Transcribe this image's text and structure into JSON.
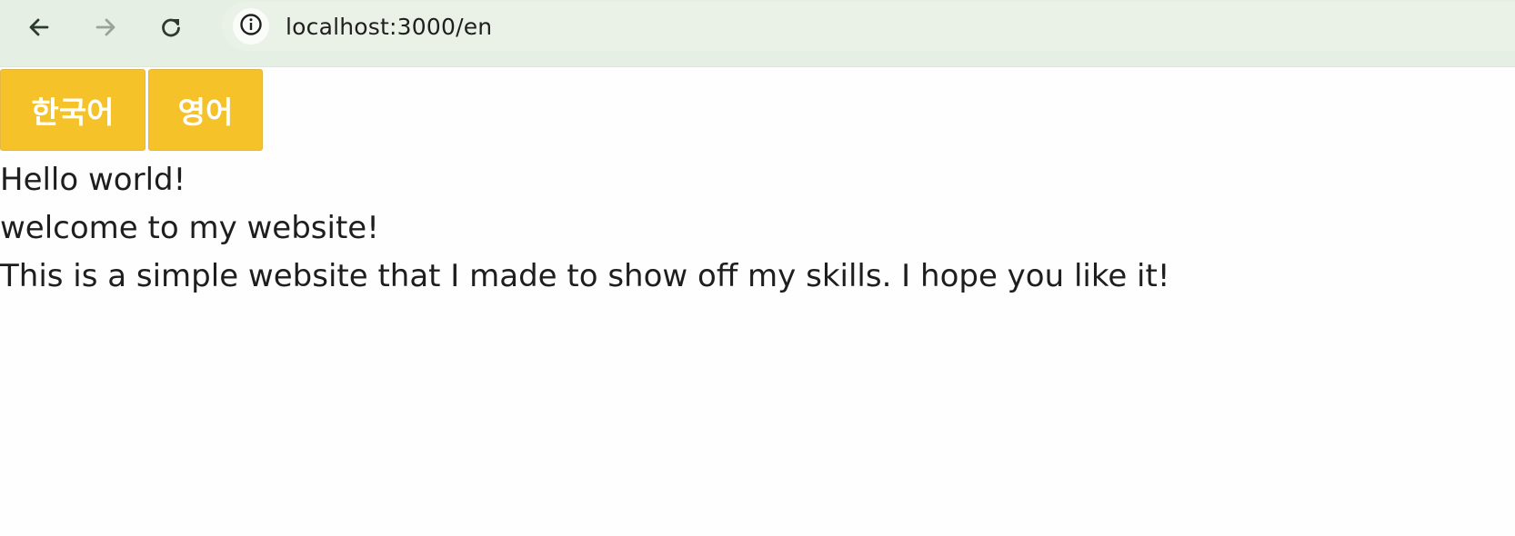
{
  "browser": {
    "url": "localhost:3000/en",
    "back_icon": "arrow-left-icon",
    "forward_icon": "arrow-right-icon",
    "reload_icon": "reload-icon",
    "info_icon": "info-icon"
  },
  "language_buttons": [
    {
      "label": "한국어"
    },
    {
      "label": "영어"
    }
  ],
  "content": {
    "heading": "Hello world!",
    "welcome": "welcome to my website!",
    "description": "This is a simple website that I made to show off my skills. I hope you like it!"
  },
  "colors": {
    "button_bg": "#f6c229",
    "button_text": "#ffffff",
    "toolbar_bg": "#e6efe4",
    "text": "#1e1e1e"
  }
}
